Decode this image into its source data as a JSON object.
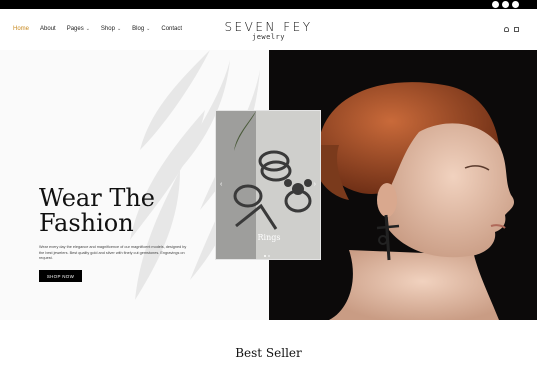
{
  "nav": {
    "items": [
      {
        "label": "Home",
        "active": true,
        "dropdown": false
      },
      {
        "label": "About",
        "active": false,
        "dropdown": false
      },
      {
        "label": "Pages",
        "active": false,
        "dropdown": true
      },
      {
        "label": "Shop",
        "active": false,
        "dropdown": true
      },
      {
        "label": "Blog",
        "active": false,
        "dropdown": true
      },
      {
        "label": "Contact",
        "active": false,
        "dropdown": false
      }
    ]
  },
  "logo": {
    "main": "SEVEN FEY",
    "sub": "jewelry"
  },
  "social_icons": [
    "facebook-icon",
    "twitter-icon",
    "pinterest-icon"
  ],
  "header_icons": [
    "user-icon",
    "cart-icon"
  ],
  "hero": {
    "title_line1": "Wear The",
    "title_line2": "Fashion",
    "text": "Wear every day the elegance and magnificence of our magnificent models, designed by the best jewelers. Best quality gold and silver with finely cut gemstones. Engravings on request.",
    "button_label": "SHOP NOW"
  },
  "card": {
    "label": "Rings",
    "slides": 2,
    "active_slide": 0
  },
  "section": {
    "title": "Best Seller"
  },
  "colors": {
    "accent": "#c8891f",
    "dark": "#000000",
    "hero_dark": "#0c0a0a"
  }
}
